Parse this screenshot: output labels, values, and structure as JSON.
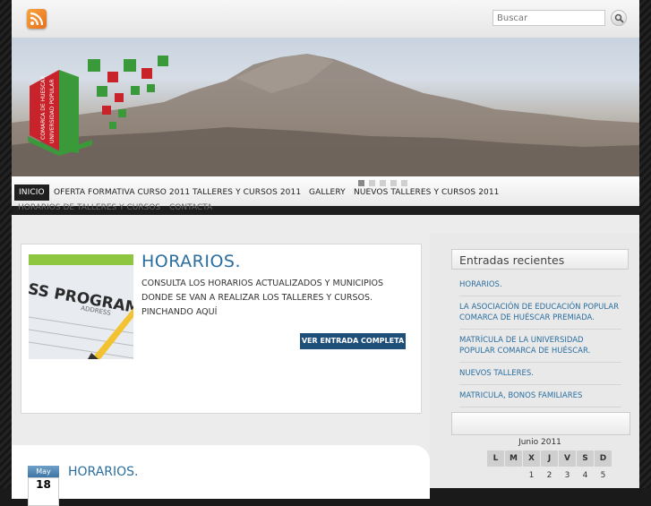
{
  "search": {
    "placeholder": "Buscar"
  },
  "logo": {
    "text": "COMARCA DE HUESCAR UNIVERSIDAD POPULAR"
  },
  "nav": {
    "items": [
      {
        "label": "INICIO",
        "active": true
      },
      {
        "label": "OFERTA FORMATIVA CURSO 2011"
      },
      {
        "label": "TALLERES Y CURSOS 2011"
      },
      {
        "label": "GALLERY"
      },
      {
        "label": "NUEVOS TALLERES Y CURSOS 2011"
      }
    ],
    "sub_items": [
      "HORARIOS DE TALLERES Y CURSOS",
      "CONTACTA"
    ]
  },
  "slider": {
    "title": "HORARIOS.",
    "text": "CONSULTA LOS HORARIOS  ACTUALIZADOS  Y MUNICIPIOS DONDE SE VAN A REALIZAR LOS TALLERES Y CURSOS. PINCHANDO AQUÍ",
    "more_label": "VER ENTRADA COMPLETA",
    "thumb_text": "ASS PROGRAM",
    "thumb_sub": "ADDRESS"
  },
  "post": {
    "month": "May",
    "day": "18",
    "title": "HORARIOS."
  },
  "sidebar": {
    "recent_title": "Entradas recientes",
    "recent": [
      "HORARIOS.",
      "LA ASOCIACIÓN DE EDUCACIÓN POPULAR COMARCA DE HUÉSCAR PREMIADA.",
      "MATRÍCULA DE LA UNIVERSIDAD POPULAR COMARCA DE HUÉSCAR.",
      "NUEVOS TALLERES.",
      "MATRICULA, BONOS FAMILIARES"
    ],
    "calendar_caption": "Junio 2011",
    "weekdays": [
      "L",
      "M",
      "X",
      "J",
      "V",
      "S",
      "D"
    ],
    "days": [
      "1",
      "2",
      "3",
      "4",
      "5"
    ]
  },
  "colors": {
    "accent": "#2a6e9f",
    "button": "#1d4f79",
    "logo_green": "#3a9a3a",
    "logo_red": "#c8232b"
  }
}
